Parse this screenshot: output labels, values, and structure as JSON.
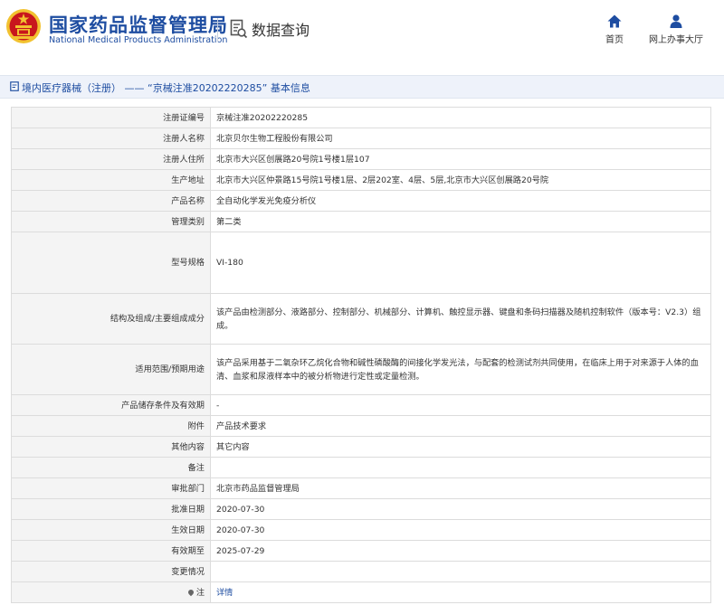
{
  "header": {
    "brand_cn": "国家药品监督管理局",
    "brand_en": "National Medical Products Administration",
    "query_label": "数据查询",
    "nav": [
      {
        "label": "首页",
        "icon": "home-icon"
      },
      {
        "label": "网上办事大厅",
        "icon": "person-icon"
      }
    ],
    "colors": {
      "brand": "#1e4da1",
      "logo_red": "#c8161d",
      "logo_gold": "#f2c230"
    }
  },
  "title_bar": {
    "text": "境内医疗器械（注册） —— “京械注准20202220285” 基本信息"
  },
  "rows": [
    {
      "label": "注册证编号",
      "value": "京械注准20202220285"
    },
    {
      "label": "注册人名称",
      "value": "北京贝尔生物工程股份有限公司"
    },
    {
      "label": "注册人住所",
      "value": "北京市大兴区创展路20号院1号楼1层107"
    },
    {
      "label": "生产地址",
      "value": "北京市大兴区仲景路15号院1号楼1层、2层202室、4层、5层,北京市大兴区创展路20号院"
    },
    {
      "label": "产品名称",
      "value": "全自动化学发光免疫分析仪"
    },
    {
      "label": "管理类别",
      "value": "第二类"
    },
    {
      "label": "型号规格",
      "value": "VI-180"
    },
    {
      "label": "结构及组成/主要组成成分",
      "value": "该产品由检测部分、液路部分、控制部分、机械部分、计算机、触控显示器、键盘和条码扫描器及随机控制软件（版本号：V2.3）组成。"
    },
    {
      "label": "适用范围/预期用途",
      "value": "该产品采用基于二氧杂环乙烷化合物和碱性磷酸酶的间接化学发光法，与配套的检测试剂共同使用，在临床上用于对来源于人体的血清、血浆和尿液样本中的被分析物进行定性或定量检测。"
    },
    {
      "label": "产品储存条件及有效期",
      "value": "-"
    },
    {
      "label": "附件",
      "value": "产品技术要求"
    },
    {
      "label": "其他内容",
      "value": "其它内容"
    },
    {
      "label": "备注",
      "value": ""
    },
    {
      "label": "审批部门",
      "value": "北京市药品监督管理局"
    },
    {
      "label": "批准日期",
      "value": "2020-07-30"
    },
    {
      "label": "生效日期",
      "value": "2020-07-30"
    },
    {
      "label": "有效期至",
      "value": "2025-07-29"
    },
    {
      "label": "变更情况",
      "value": ""
    },
    {
      "label": "注",
      "value": "详情"
    }
  ]
}
